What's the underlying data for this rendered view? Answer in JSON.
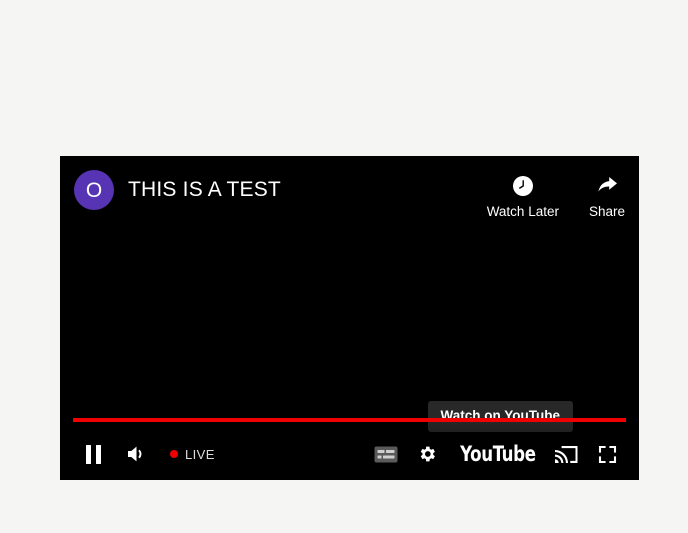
{
  "page": {
    "background_color": "#f5f5f3"
  },
  "player": {
    "background_color": "#000000",
    "accent_color": "#f00000",
    "avatar": {
      "initial": "O",
      "color": "#5734b3",
      "icon": "channel-avatar"
    },
    "title": "THIS IS A TEST",
    "top_actions": [
      {
        "label": "Watch Later",
        "icon": "clock-icon"
      },
      {
        "label": "Share",
        "icon": "share-arrow-icon"
      }
    ],
    "watch_on_youtube": {
      "label": "Watch on YouTube"
    },
    "progress": {
      "percent": 100
    },
    "controls_left": [
      {
        "name": "pause-button",
        "icon": "pause-icon"
      },
      {
        "name": "volume-button",
        "icon": "volume-high-icon"
      },
      {
        "name": "live-badge",
        "label": "LIVE",
        "dot_color": "#f00000"
      }
    ],
    "controls_right": [
      {
        "name": "subtitles-button",
        "icon": "subtitles-cc-icon"
      },
      {
        "name": "settings-button",
        "icon": "gear-icon"
      },
      {
        "name": "youtube-wordmark",
        "label": "YouTube"
      },
      {
        "name": "cast-button",
        "icon": "cast-icon"
      },
      {
        "name": "fullscreen-button",
        "icon": "fullscreen-icon"
      }
    ]
  }
}
